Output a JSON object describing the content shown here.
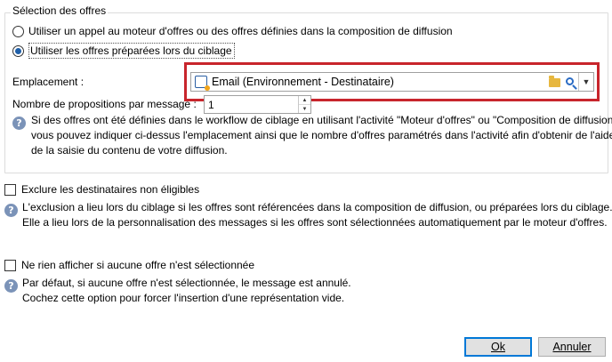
{
  "offers_group": {
    "title": "Sélection des offres",
    "option_engine": "Utiliser un appel au moteur d'offres ou des offres définies dans la composition de diffusion",
    "option_prepared": "Utiliser les offres préparées lors du ciblage",
    "selected_option": "option_prepared",
    "location_label": "Emplacement :",
    "location_value": "Email (Environnement - Destinataire)",
    "proposals_label": "Nombre de propositions par message :",
    "proposals_value": "1",
    "help_lines": [
      "Si des offres ont été définies dans le workflow de ciblage en utilisant l'activité \"Moteur d'offres\" ou \"Composition de diffusion\",",
      "vous pouvez indiquer ci-dessus l'emplacement ainsi que le nombre d'offres paramétrés dans l'activité afin d'obtenir de l'aide lors",
      "de la saisie du contenu de votre diffusion."
    ]
  },
  "exclude": {
    "label": "Exclure les destinataires non éligibles",
    "checked": false,
    "help_lines": [
      "L'exclusion a lieu lors du ciblage si les offres sont référencées dans la composition de diffusion, ou préparées lors du ciblage.",
      "Elle a lieu lors de la personnalisation des messages si les offres sont sélectionnées automatiquement par le moteur d'offres."
    ]
  },
  "no_display": {
    "label": "Ne rien afficher si aucune offre n'est sélectionnée",
    "checked": false,
    "help_lines": [
      "Par défaut, si aucune offre n'est sélectionnée, le message est annulé.",
      "Cochez cette option pour forcer l'insertion d'une représentation vide."
    ]
  },
  "buttons": {
    "ok_label": "Ok",
    "cancel_label": "Annuler"
  },
  "colors": {
    "highlight": "#c8252c",
    "accent": "#1f5fa8",
    "help_icon": "#7b93b8"
  },
  "icons": {
    "help": "?",
    "dropdown": "▼",
    "spin_up": "▲",
    "spin_down": "▼"
  }
}
